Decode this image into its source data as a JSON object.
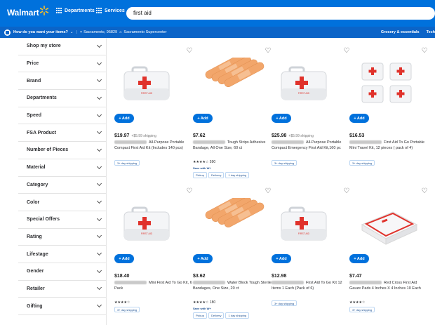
{
  "header": {
    "logo": "Walmart",
    "departments": "Departments",
    "services": "Services",
    "search_value": "first aid"
  },
  "subbar": {
    "question": "How do you want your items?",
    "location": "Sacramento, 95829",
    "store": "Sacramento Supercenter",
    "right_link": "Grocery & essentials",
    "right_cut": "Tech"
  },
  "sidebar": [
    "Shop my store",
    "Price",
    "Brand",
    "Departments",
    "Speed",
    "FSA Product",
    "Number of Pieces",
    "Material",
    "Category",
    "Color",
    "Special Offers",
    "Rating",
    "Lifestage",
    "Gender",
    "Retailer",
    "Gifting"
  ],
  "add_label": "+ Add",
  "products": [
    {
      "price": "$19.97",
      "was": "+$5.99 shipping",
      "title": "All-Purpose Portable Compact First Aid Kit (Includes 140 pcs)",
      "ship": "3+ day shipping",
      "img": "kit"
    },
    {
      "price": "$7.62",
      "title": "Tough Strips Adhesive Bandage, All One Size, 60 ct",
      "stars": "★★★★☆ 590",
      "saves": "Save with W+",
      "tags": [
        "Pickup",
        "Delivery",
        "1 day shipping"
      ],
      "img": "band"
    },
    {
      "price": "$25.98",
      "was": "+$5.99 shipping",
      "title": "All-Purpose Portable Compact Emergency First Aid Kit,160 pc",
      "ship": "3+ day shipping",
      "img": "kit"
    },
    {
      "price": "$16.53",
      "title": "First Aid To Go Portable Mini Travel Kit, 12 pieces ( pack of 4)",
      "ship": "3+ day shipping",
      "img": "minikits"
    },
    {
      "price": "$18.40",
      "title": "Mini First Aid To Go Kit, 6 Pack",
      "stars": "★★★★☆",
      "ship": "3+ day shipping",
      "img": "kit"
    },
    {
      "price": "$3.62",
      "title": "Water Block Tough Sterile Bandages, One Size, 20 ct",
      "stars": "★★★★☆ 180",
      "saves": "Save with W+",
      "tags": [
        "Pickup",
        "Delivery",
        "1 day shipping"
      ],
      "img": "band"
    },
    {
      "price": "$12.98",
      "title": "First Aid To Go Kit 12 Items 1 Each (Pack of 6)",
      "ship": "3+ day shipping",
      "img": "kit"
    },
    {
      "price": "$7.47",
      "title": "Red Cross First Aid Gauze Pads 4 Inches X 4 Inches 10 Each",
      "stars": "★★★★☆",
      "ship": "3+ day shipping",
      "img": "gauze"
    }
  ],
  "kit_label": "FIRST AID",
  "colors": {
    "brand_blue": "#0071dc",
    "spark_yellow": "#ffc220",
    "kit_red": "#e0322b",
    "bandage": "#f2a66b"
  }
}
